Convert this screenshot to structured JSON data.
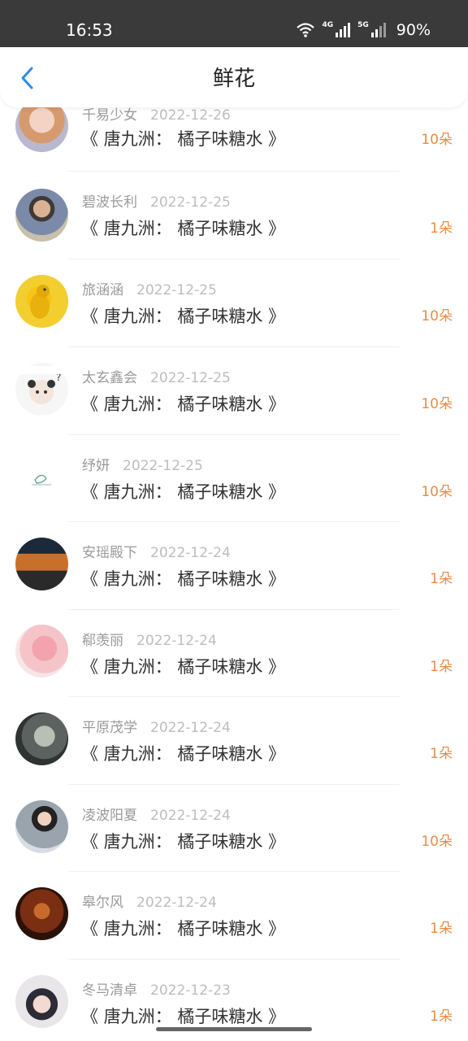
{
  "status_bar": {
    "time": "16:53",
    "network_4g": "4G",
    "network_5g": "5G",
    "battery": "90%"
  },
  "header": {
    "title": "鲜花",
    "back_icon": "chevron-left-icon"
  },
  "colors": {
    "accent": "#2f8be6",
    "count": "#ea8c45",
    "name": "#9a9a9a",
    "date": "#bdbdbd"
  },
  "items": [
    {
      "user": "千易少女",
      "date": "2022-12-26",
      "title": "《 唐九洲： 橘子味糖水 》",
      "count": "10朵",
      "avatar": "avatar-girl-icon"
    },
    {
      "user": "碧波长利",
      "date": "2022-12-25",
      "title": "《 唐九洲： 橘子味糖水 》",
      "count": "1朵",
      "avatar": "avatar-boy-icon"
    },
    {
      "user": "旅涵涵",
      "date": "2022-12-25",
      "title": "《 唐九洲： 橘子味糖水 》",
      "count": "10朵",
      "avatar": "avatar-duck-icon"
    },
    {
      "user": "太玄鑫会",
      "date": "2022-12-25",
      "title": "《 唐九洲： 橘子味糖水 》",
      "count": "10朵",
      "avatar": "avatar-sticker-icon"
    },
    {
      "user": "纾妍",
      "date": "2022-12-25",
      "title": "《 唐九洲： 橘子味糖水 》",
      "count": "10朵",
      "avatar": "avatar-sketch-icon"
    },
    {
      "user": "安瑶殿下",
      "date": "2022-12-24",
      "title": "《 唐九洲： 橘子味糖水 》",
      "count": "1朵",
      "avatar": "avatar-car-icon"
    },
    {
      "user": "郗羡丽",
      "date": "2022-12-24",
      "title": "《 唐九洲： 橘子味糖水 》",
      "count": "1朵",
      "avatar": "avatar-balloon-icon"
    },
    {
      "user": "平原茂学",
      "date": "2022-12-24",
      "title": "《 唐九洲： 橘子味糖水 》",
      "count": "1朵",
      "avatar": "avatar-portrait-icon"
    },
    {
      "user": "凌波阳夏",
      "date": "2022-12-24",
      "title": "《 唐九洲： 橘子味糖水 》",
      "count": "10朵",
      "avatar": "avatar-woman-icon"
    },
    {
      "user": "皋尔风",
      "date": "2022-12-24",
      "title": "《 唐九洲： 橘子味糖水 》",
      "count": "1朵",
      "avatar": "avatar-dark-icon"
    },
    {
      "user": "冬马清卓",
      "date": "2022-12-23",
      "title": "《 唐九洲： 橘子味糖水 》",
      "count": "1朵",
      "avatar": "avatar-cap-girl-icon"
    }
  ]
}
